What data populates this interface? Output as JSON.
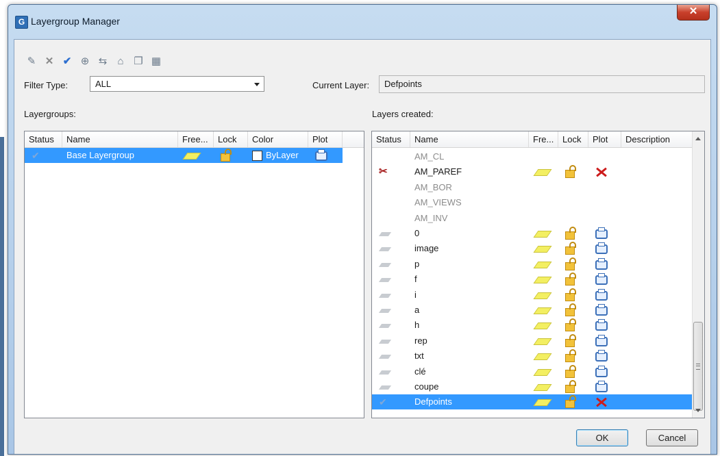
{
  "window": {
    "title": "Layergroup Manager",
    "close_glyph": "✕"
  },
  "toolbar": {
    "icons": [
      "new-layergroup-icon",
      "delete-icon",
      "set-current-icon",
      "zoom-icon",
      "merge-icon",
      "properties-icon",
      "copy-icon",
      "grid-icon"
    ]
  },
  "filter": {
    "label": "Filter Type:",
    "value": "ALL"
  },
  "current_layer": {
    "label": "Current Layer:",
    "value": "Defpoints"
  },
  "layergroups": {
    "label": "Layergroups:",
    "columns": [
      "Status",
      "Name",
      "Free...",
      "Lock",
      "Color",
      "Plot"
    ],
    "rows": [
      {
        "name": "Base Layergroup",
        "color": "ByLayer",
        "selected": true
      }
    ]
  },
  "layers": {
    "label": "Layers created:",
    "columns": [
      "Status",
      "Name",
      "Fre...",
      "Lock",
      "Plot",
      "Description"
    ],
    "rows": [
      {
        "name": "AM_CL",
        "style": "gray"
      },
      {
        "name": "AM_PAREF",
        "style": "special"
      },
      {
        "name": "AM_BOR",
        "style": "gray"
      },
      {
        "name": "AM_VIEWS",
        "style": "gray"
      },
      {
        "name": "AM_INV",
        "style": "gray"
      },
      {
        "name": "0",
        "style": "normal"
      },
      {
        "name": "image",
        "style": "normal"
      },
      {
        "name": "p",
        "style": "normal"
      },
      {
        "name": "f",
        "style": "normal"
      },
      {
        "name": "i",
        "style": "normal"
      },
      {
        "name": "a",
        "style": "normal"
      },
      {
        "name": "h",
        "style": "normal"
      },
      {
        "name": "rep",
        "style": "normal"
      },
      {
        "name": "txt",
        "style": "normal"
      },
      {
        "name": "clé",
        "style": "normal"
      },
      {
        "name": "coupe",
        "style": "normal"
      },
      {
        "name": "Defpoints",
        "style": "selected"
      }
    ]
  },
  "buttons": {
    "ok": "OK",
    "cancel": "Cancel"
  },
  "colors": {
    "selection": "#3399ff",
    "title_bg": "#bcd3ec",
    "close": "#c8402b"
  }
}
